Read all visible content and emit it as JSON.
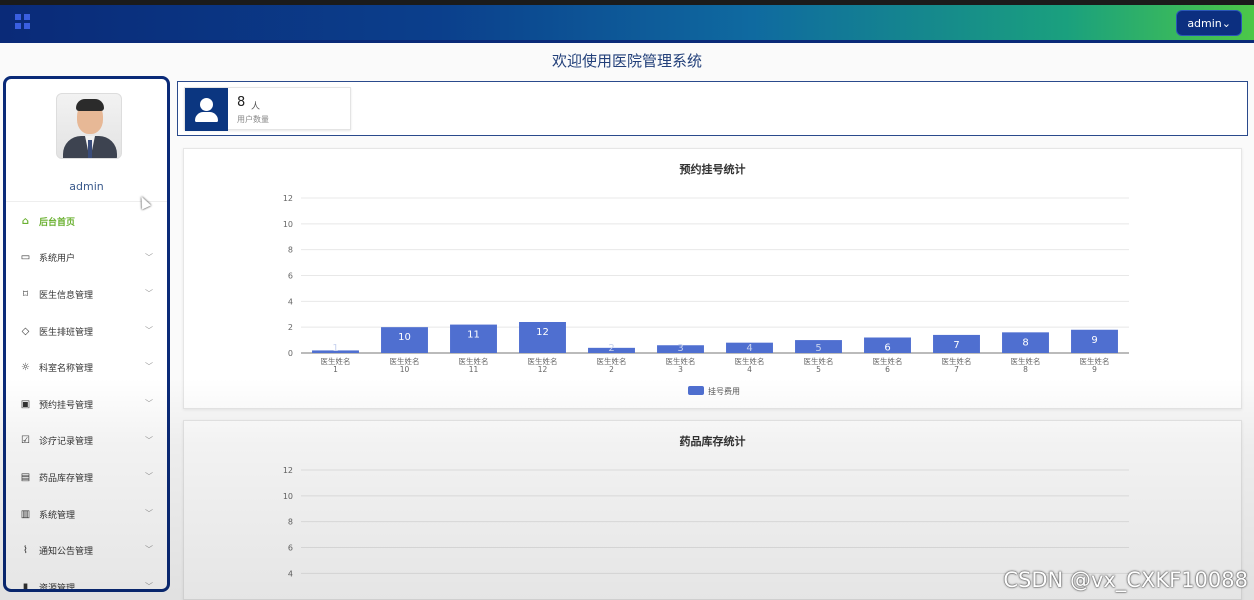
{
  "header": {
    "user_button": "admin⌄"
  },
  "welcome": "欢迎使用医院管理系统",
  "sidebar": {
    "username": "admin",
    "items": [
      {
        "label": "后台首页",
        "icon": "home-icon",
        "active": true
      },
      {
        "label": "系统用户",
        "icon": "laptop-icon"
      },
      {
        "label": "医生信息管理",
        "icon": "bookmark-icon"
      },
      {
        "label": "医生排班管理",
        "icon": "tag-icon"
      },
      {
        "label": "科室名称管理",
        "icon": "sun-icon"
      },
      {
        "label": "预约挂号管理",
        "icon": "inbox-icon"
      },
      {
        "label": "诊疗记录管理",
        "icon": "clipboard-check-icon"
      },
      {
        "label": "药品库存管理",
        "icon": "message-icon"
      },
      {
        "label": "系统管理",
        "icon": "archive-icon"
      },
      {
        "label": "通知公告管理",
        "icon": "paperclip-icon"
      },
      {
        "label": "资源管理",
        "icon": "folder-icon"
      }
    ]
  },
  "stat": {
    "value": "8",
    "unit": "人",
    "label": "用户数量"
  },
  "chart_data": [
    {
      "type": "bar",
      "title": "预约挂号统计",
      "categories": [
        "医生姓名\n1",
        "医生姓名\n10",
        "医生姓名\n11",
        "医生姓名\n12",
        "医生姓名\n2",
        "医生姓名\n3",
        "医生姓名\n4",
        "医生姓名\n5",
        "医生姓名\n6",
        "医生姓名\n7",
        "医生姓名\n8",
        "医生姓名\n9"
      ],
      "series": [
        {
          "name": "挂号费用",
          "values": [
            0.2,
            2.0,
            2.2,
            2.4,
            0.4,
            0.6,
            0.8,
            1.0,
            1.2,
            1.4,
            1.6,
            1.8
          ]
        }
      ],
      "data_labels": [
        "1",
        "10",
        "11",
        "12",
        "2",
        "3",
        "4",
        "5",
        "6",
        "7",
        "8",
        "9"
      ],
      "ylim": [
        0,
        12
      ],
      "yticks": [
        0,
        2,
        4,
        6,
        8,
        10,
        12
      ],
      "grid": true,
      "legend": "bottom-center",
      "color": "#4f6fd0"
    },
    {
      "type": "bar",
      "title": "药品库存统计",
      "ylim": [
        0,
        12
      ],
      "yticks": [
        4,
        6,
        8,
        10,
        12
      ],
      "grid": true
    }
  ],
  "watermark": "CSDN @vx_CXKF10088"
}
